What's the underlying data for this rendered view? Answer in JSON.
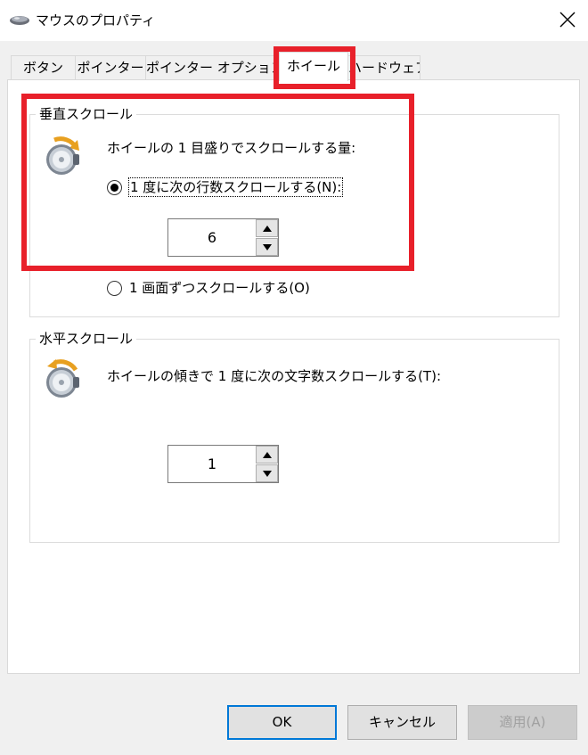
{
  "window": {
    "title": "マウスのプロパティ"
  },
  "tabs": [
    {
      "label": "ボタン",
      "active": false
    },
    {
      "label": "ポインター",
      "active": false
    },
    {
      "label": "ポインター オプション",
      "active": false
    },
    {
      "label": "ホイール",
      "active": true
    },
    {
      "label": "ハードウェア",
      "active": false
    }
  ],
  "vertical": {
    "group_title": "垂直スクロール",
    "prompt": "ホイールの 1 目盛りでスクロールする量:",
    "option_lines": "1 度に次の行数スクロールする(N):",
    "option_lines_selected": true,
    "lines_value": "6",
    "option_screen": "1 画面ずつスクロールする(O)",
    "option_screen_selected": false
  },
  "horizontal": {
    "group_title": "水平スクロール",
    "prompt": "ホイールの傾きで 1 度に次の文字数スクロールする(T):",
    "chars_value": "1"
  },
  "buttons": {
    "ok": "OK",
    "cancel": "キャンセル",
    "apply": "適用(A)"
  },
  "colors": {
    "highlight": "#e8202a",
    "focus": "#0078d7"
  }
}
